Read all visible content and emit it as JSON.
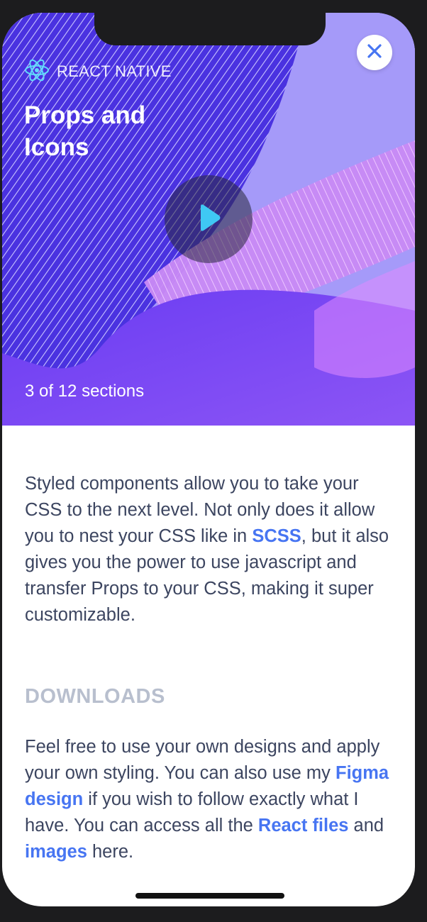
{
  "hero": {
    "brand": "REACT NATIVE",
    "title": "Props and Icons",
    "progress": "3 of 12 sections"
  },
  "body": {
    "intro": {
      "t1": "Styled components allow you to take your CSS to the next level. Not only does it allow you to nest your CSS like in ",
      "link_scss": "SCSS",
      "t2": ", but it also gives you the power to use javascript and transfer Props to your CSS, making it super customizable."
    },
    "downloads_heading": "DOWNLOADS",
    "downloads": {
      "t1": "Feel free to use your own designs and apply your own styling. You can also use my ",
      "link_figma": "Figma design",
      "t2": " if you wish to follow exactly what I have. You can access all the ",
      "link_react": "React files",
      "t3": " and ",
      "link_images": "images",
      "t4": " here."
    }
  },
  "icons": {
    "close": "close-icon",
    "play": "play-icon",
    "brand": "react-logo-icon"
  },
  "colors": {
    "accent": "#4775f2",
    "play": "#3fc8f4",
    "text": "#3c4560",
    "muted": "#b8bfce"
  }
}
